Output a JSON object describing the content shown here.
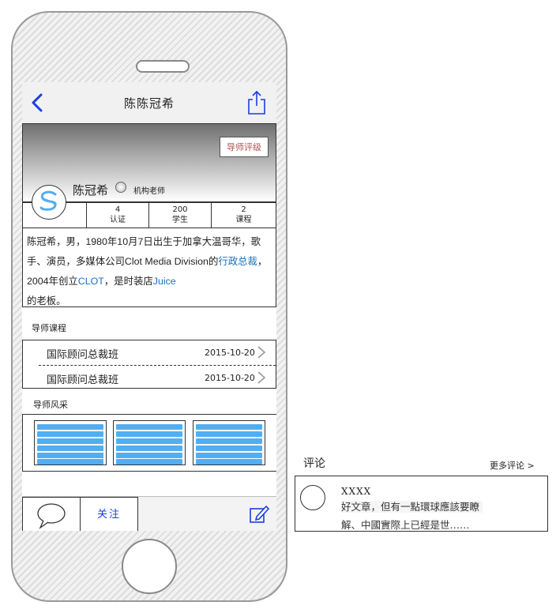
{
  "nav": {
    "title": "陈陈冠希"
  },
  "profile": {
    "rating_button": "导师评级",
    "name": "陈冠希",
    "role": "机构老师"
  },
  "stats": [
    {
      "value": "",
      "label": ""
    },
    {
      "value": "4",
      "label": "认证"
    },
    {
      "value": "200",
      "label": "学生"
    },
    {
      "value": "2",
      "label": "课程"
    }
  ],
  "bio": {
    "p1": "陈冠希，男，1980年10月7日出生于加拿大温哥华，歌手、演员，多媒体公司Clot Media Division的",
    "link1": "行政总裁",
    "p2": "，2004年创立",
    "link2": "CLOT",
    "p3": "，是时装店",
    "link3": "Juice",
    "p4": "的老板。"
  },
  "courses_section": {
    "title": "导师课程"
  },
  "courses": [
    {
      "name": "国际顾问总裁班",
      "date": "2015-10-20"
    },
    {
      "name": "国际顾问总裁班",
      "date": "2015-10-20"
    }
  ],
  "gallery_section": {
    "title": "导师风采"
  },
  "tabbar": {
    "follow_label": "关注"
  },
  "comments": {
    "title": "评论",
    "more": "更多评论 >",
    "user": "XXXX",
    "line1": "好文章，但有一點環球應該要瞭",
    "line2": "解、中國實際上已經是世……"
  },
  "colors": {
    "link": "#1a6fc0",
    "accent": "#1a3fe0",
    "thumb": "#52aef0",
    "rating_text": "#b05050"
  }
}
